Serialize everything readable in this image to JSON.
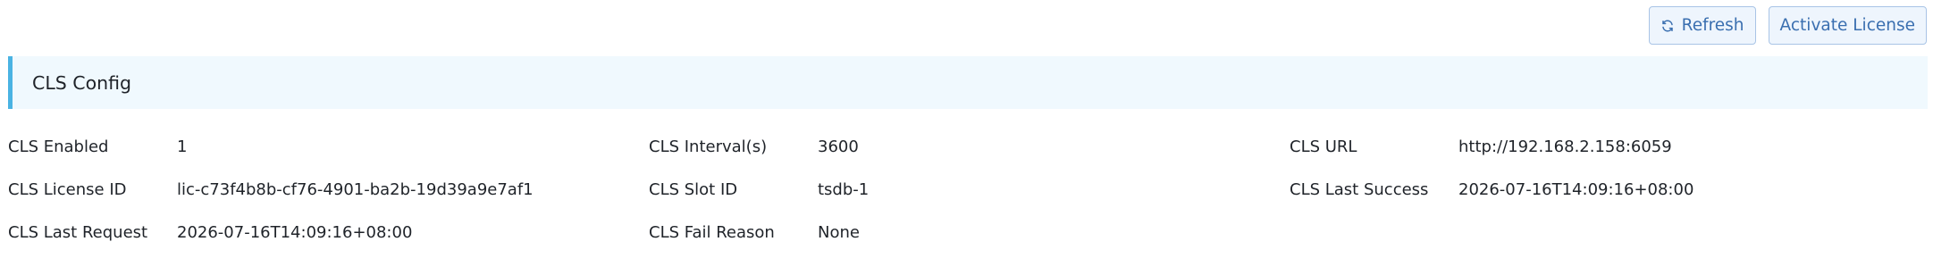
{
  "toolbar": {
    "refresh_label": "Refresh",
    "activate_label": "Activate License",
    "refresh_icon": "refresh-icon"
  },
  "section": {
    "title": "CLS Config"
  },
  "fields": {
    "cls_enabled": {
      "label": "CLS Enabled",
      "value": "1"
    },
    "cls_interval": {
      "label": "CLS Interval(s)",
      "value": "3600"
    },
    "cls_url": {
      "label": "CLS URL",
      "value": "http://192.168.2.158:6059"
    },
    "cls_license_id": {
      "label": "CLS License ID",
      "value": "lic-c73f4b8b-cf76-4901-ba2b-19d39a9e7af1"
    },
    "cls_slot_id": {
      "label": "CLS Slot ID",
      "value": "tsdb-1"
    },
    "cls_last_success": {
      "label": "CLS Last Success",
      "value": "2026-07-16T14:09:16+08:00"
    },
    "cls_last_request": {
      "label": "CLS Last Request",
      "value": "2026-07-16T14:09:16+08:00"
    },
    "cls_fail_reason": {
      "label": "CLS Fail Reason",
      "value": "None"
    }
  },
  "colors": {
    "accent": "#4ab3e3",
    "header_bg": "#f0f9fe",
    "button_text": "#3a6fb0",
    "button_border": "#a9c4e6",
    "button_bg": "#eef5fd"
  }
}
